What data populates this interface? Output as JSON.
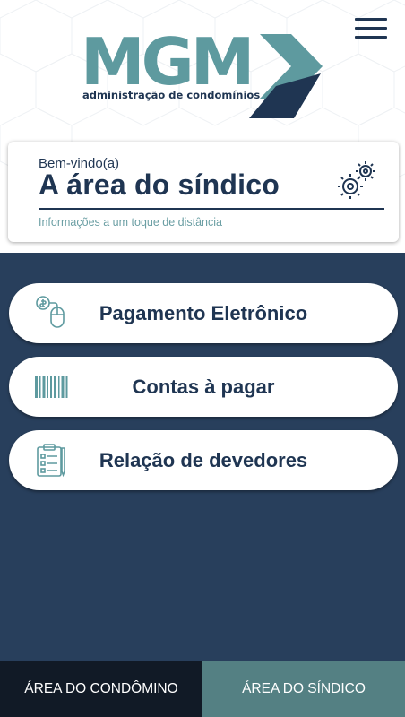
{
  "brand": {
    "logo_text": "MGM",
    "tagline": "administração de condomínios",
    "colors": {
      "teal": "#5e9a9f",
      "navy": "#1f3552",
      "background": "#283f5c"
    }
  },
  "header": {
    "menu_icon": "hamburger-icon"
  },
  "welcome": {
    "greeting": "Bem-vindo(a)",
    "title": "A área do síndico",
    "subtitle": "Informações a um toque de distância",
    "icon": "gear-icon"
  },
  "menu": {
    "items": [
      {
        "label": "Pagamento Eletrônico",
        "icon": "payment-mouse-icon"
      },
      {
        "label": "Contas à pagar",
        "icon": "barcode-icon"
      },
      {
        "label": "Relação de devedores",
        "icon": "clipboard-list-icon"
      }
    ]
  },
  "bottom_nav": {
    "tabs": [
      {
        "label": "ÁREA DO CONDÔMINO",
        "active": false
      },
      {
        "label": "ÁREA DO SÍNDICO",
        "active": true
      }
    ]
  }
}
